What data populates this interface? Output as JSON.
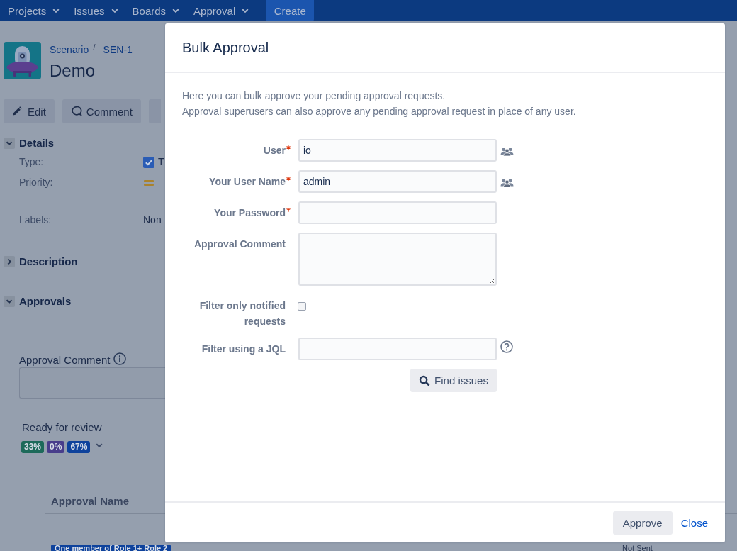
{
  "top_nav": {
    "menus": [
      {
        "label": "Projects"
      },
      {
        "label": "Issues"
      },
      {
        "label": "Boards"
      },
      {
        "label": "Approval"
      }
    ],
    "create_button": "Create"
  },
  "issue": {
    "breadcrumb": [
      {
        "label": "Scenario"
      },
      {
        "label": "SEN-1"
      }
    ],
    "separator": "/",
    "title": "Demo",
    "actions": [
      {
        "kind": "edit",
        "label": "Edit"
      },
      {
        "kind": "comment",
        "label": "Comment"
      },
      {
        "kind": "more"
      }
    ],
    "details": {
      "title": "Details",
      "expanded": true,
      "fields": [
        {
          "kind": "type",
          "label": "Type:",
          "value": "T"
        },
        {
          "kind": "priority",
          "label": "Priority:"
        },
        {
          "kind": "text",
          "label": "Labels:",
          "value": "Non"
        }
      ]
    },
    "description": {
      "title": "Description",
      "expanded": false
    },
    "approvals": {
      "title": "Approvals",
      "expanded": true,
      "comment_label": "Approval Comment",
      "status": "Ready for review",
      "progress": [
        {
          "text": "33%",
          "color": "#1d6a5a"
        },
        {
          "text": "0%",
          "color": "#483d8b"
        },
        {
          "text": "67%",
          "color": "#0e429c"
        }
      ],
      "table": {
        "columns": [
          "Approval Name"
        ],
        "rows": [
          {
            "name": "One member of Role 1+ Role 2",
            "status": "Not Sent"
          }
        ]
      }
    }
  },
  "modal": {
    "title": "Bulk Approval",
    "intro": [
      "Here you can bulk approve your pending approval requests.",
      "Approval superusers can also approve any pending approval request in place of any user."
    ],
    "fields": [
      {
        "kind": "user",
        "label": "User",
        "required": true,
        "value": "io"
      },
      {
        "kind": "user",
        "label": "Your User Name",
        "required": true,
        "value": "admin"
      },
      {
        "kind": "password",
        "label": "Your Password",
        "required": true
      },
      {
        "kind": "textarea",
        "label": "Approval Comment",
        "required": false
      },
      {
        "kind": "checkbox",
        "label": "Filter only notified requests",
        "required": false,
        "checked": false
      },
      {
        "kind": "jql",
        "label": "Filter using a JQL",
        "required": false
      }
    ],
    "find_button": "Find issues",
    "footer": {
      "approve": "Approve",
      "close": "Close"
    }
  }
}
